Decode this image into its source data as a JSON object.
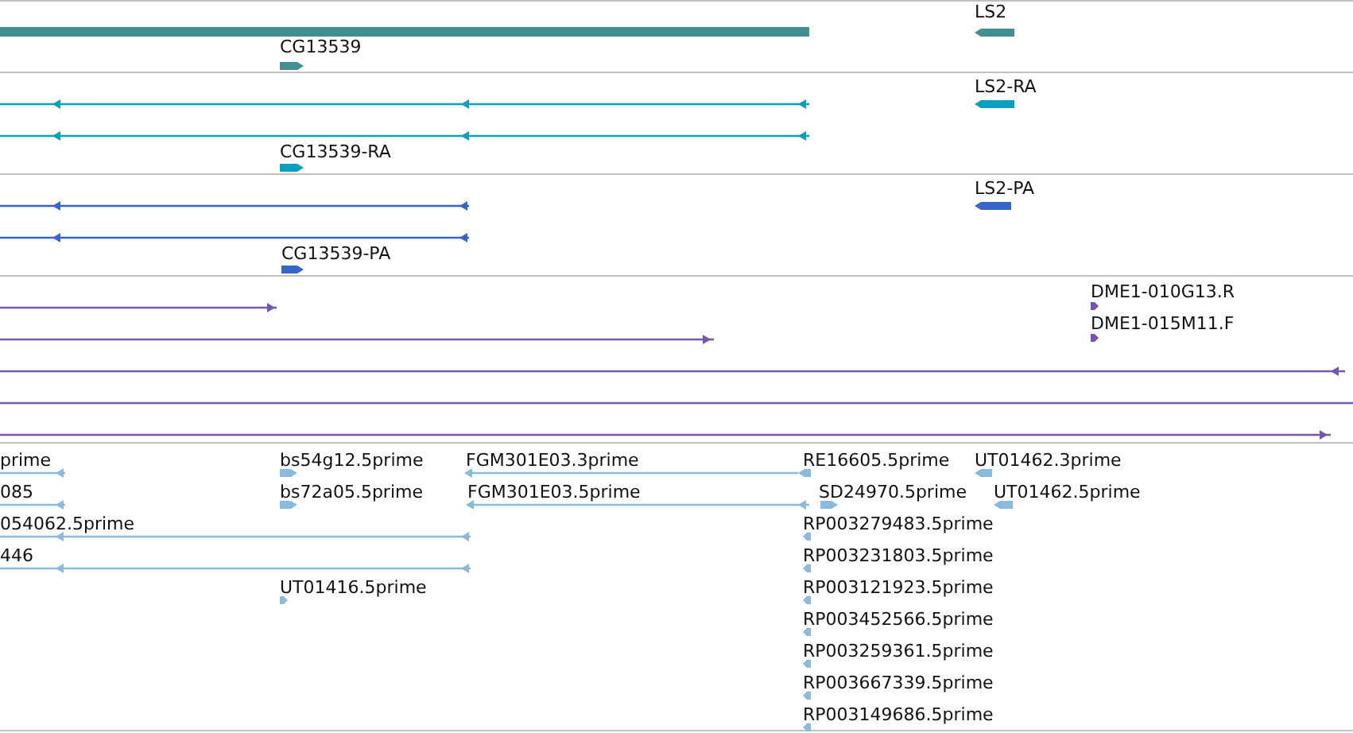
{
  "tracks": [
    {
      "color": "#428f8f",
      "features": [
        {
          "kind": "bar"
        },
        {
          "kind": "block",
          "label": "CG13539",
          "reverse": false
        },
        {
          "kind": "block",
          "label": "LS2",
          "reverse": true
        }
      ]
    },
    {
      "color": "#0aa0c0",
      "features": [
        {
          "kind": "line",
          "reverse": true
        },
        {
          "kind": "line",
          "reverse": true
        },
        {
          "kind": "block",
          "label": "CG13539-RA",
          "reverse": false
        },
        {
          "kind": "block",
          "label": "LS2-RA",
          "reverse": true
        }
      ]
    },
    {
      "color": "#3366cc",
      "features": [
        {
          "kind": "line",
          "reverse": true
        },
        {
          "kind": "line",
          "reverse": true
        },
        {
          "kind": "block",
          "label": "CG13539-PA",
          "reverse": false
        },
        {
          "kind": "block",
          "label": "LS2-PA",
          "reverse": true
        }
      ]
    },
    {
      "color": "#7755aa",
      "features": [
        {
          "kind": "line",
          "reverse": false
        },
        {
          "kind": "block",
          "label": "DME1-010G13.R",
          "reverse": false
        },
        {
          "kind": "line",
          "reverse": false
        },
        {
          "kind": "block",
          "label": "DME1-015M11.F",
          "reverse": false
        },
        {
          "kind": "line",
          "reverse": true
        },
        {
          "kind": "line"
        },
        {
          "kind": "line",
          "reverse": false
        }
      ]
    },
    {
      "color": "#88bbdd",
      "features": [
        {
          "kind": "line",
          "label": "prime",
          "reverse": true
        },
        {
          "kind": "block",
          "label": "bs54g12.5prime",
          "reverse": false
        },
        {
          "kind": "line",
          "label": "FGM301E03.3prime",
          "reverse": true
        },
        {
          "kind": "block",
          "label": "RE16605.5prime",
          "reverse": true
        },
        {
          "kind": "block",
          "label": "UT01462.3prime",
          "reverse": true
        },
        {
          "kind": "line",
          "label": "085",
          "reverse": true
        },
        {
          "kind": "block",
          "label": "bs72a05.5prime",
          "reverse": false
        },
        {
          "kind": "line",
          "label": "FGM301E03.5prime",
          "reverse": true
        },
        {
          "kind": "block",
          "label": "SD24970.5prime",
          "reverse": false
        },
        {
          "kind": "block",
          "label": "UT01462.5prime",
          "reverse": true
        },
        {
          "kind": "line",
          "label": "054062.5prime",
          "reverse": true
        },
        {
          "kind": "block",
          "label": "RP003279483.5prime",
          "reverse": true
        },
        {
          "kind": "line",
          "label": "446",
          "reverse": true
        },
        {
          "kind": "block",
          "label": "RP003231803.5prime",
          "reverse": true
        },
        {
          "kind": "block",
          "label": "UT01416.5prime",
          "reverse": false
        },
        {
          "kind": "block",
          "label": "RP003121923.5prime",
          "reverse": true
        },
        {
          "kind": "block",
          "label": "RP003452566.5prime",
          "reverse": true
        },
        {
          "kind": "block",
          "label": "RP003259361.5prime",
          "reverse": true
        },
        {
          "kind": "block",
          "label": "RP003667339.5prime",
          "reverse": true
        },
        {
          "kind": "block",
          "label": "RP003149686.5prime",
          "reverse": true
        }
      ]
    }
  ]
}
